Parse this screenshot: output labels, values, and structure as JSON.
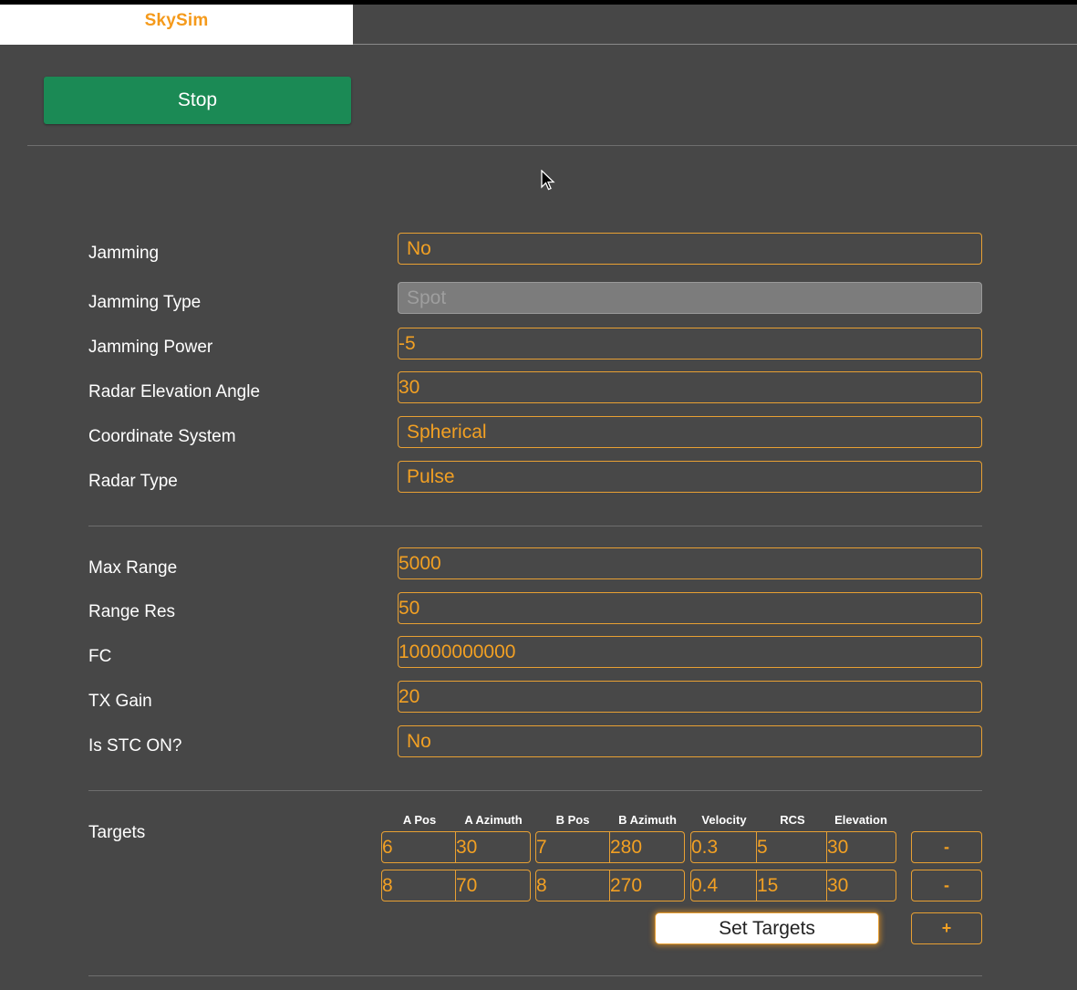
{
  "app": {
    "tab_title": "SkySim"
  },
  "toolbar": {
    "stop_label": "Stop"
  },
  "settings": {
    "jamming": {
      "label": "Jamming",
      "value": "No"
    },
    "jamming_type": {
      "label": "Jamming Type",
      "value": "Spot"
    },
    "jamming_power": {
      "label": "Jamming Power",
      "value": "-5"
    },
    "radar_elevation_angle": {
      "label": "Radar Elevation Angle",
      "value": "30"
    },
    "coordinate_system": {
      "label": "Coordinate System",
      "value": "Spherical"
    },
    "radar_type": {
      "label": "Radar Type",
      "value": "Pulse"
    },
    "max_range": {
      "label": "Max Range",
      "value": "5000"
    },
    "range_res": {
      "label": "Range Res",
      "value": "50"
    },
    "fc": {
      "label": "FC",
      "value": "10000000000"
    },
    "tx_gain": {
      "label": "TX Gain",
      "value": "20"
    },
    "stc_on": {
      "label": "Is STC ON?",
      "value": "No"
    }
  },
  "targets": {
    "label": "Targets",
    "columns": [
      "A Pos",
      "A Azimuth",
      "B Pos",
      "B Azimuth",
      "Velocity",
      "RCS",
      "Elevation"
    ],
    "rows": [
      [
        "6",
        "30",
        "7",
        "280",
        "0.3",
        "5",
        "30"
      ],
      [
        "8",
        "70",
        "8",
        "270",
        "0.4",
        "15",
        "30"
      ]
    ],
    "remove_label": "-",
    "add_label": "+",
    "set_label": "Set Targets"
  },
  "colors": {
    "accent": "#f59a1b",
    "stop_button": "#1b8a55",
    "background": "#474747"
  }
}
